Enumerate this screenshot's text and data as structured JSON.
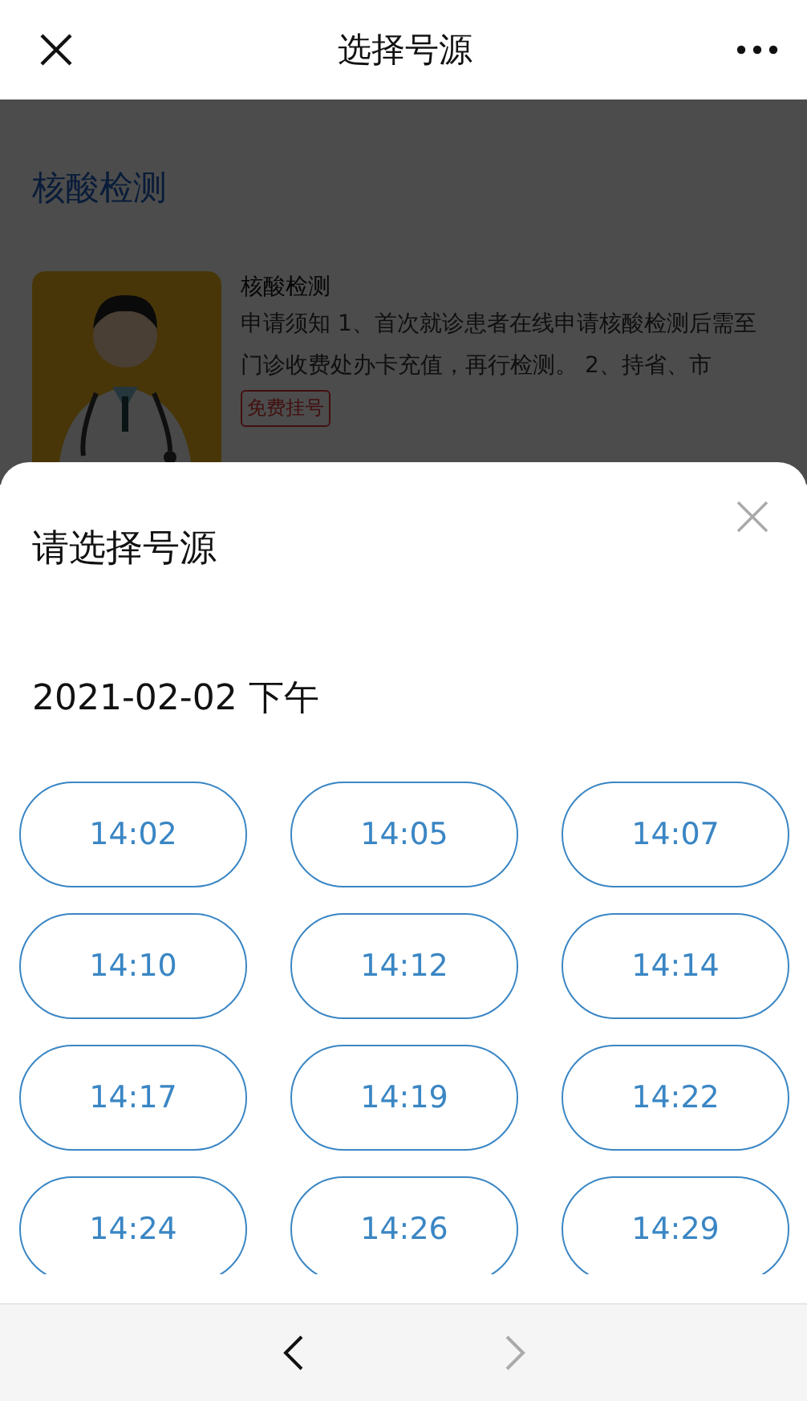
{
  "nav_bar": {
    "title": "选择号源"
  },
  "background": {
    "section_title": "核酸检测",
    "card": {
      "title": "核酸检测",
      "description": "申请须知 1、首次就诊患者在线申请核酸检测后需至门诊收费处办卡充值，再行检测。 2、持省、市",
      "tag": "免费挂号"
    }
  },
  "sheet": {
    "title": "请选择号源",
    "date": "2021-02-02 下午",
    "slots": [
      "14:02",
      "14:05",
      "14:07",
      "14:10",
      "14:12",
      "14:14",
      "14:17",
      "14:19",
      "14:22",
      "14:24",
      "14:26",
      "14:29"
    ]
  },
  "bottom_bar": [
    {
      "kind": "back",
      "disabled": false
    },
    {
      "kind": "forward",
      "disabled": true
    }
  ]
}
